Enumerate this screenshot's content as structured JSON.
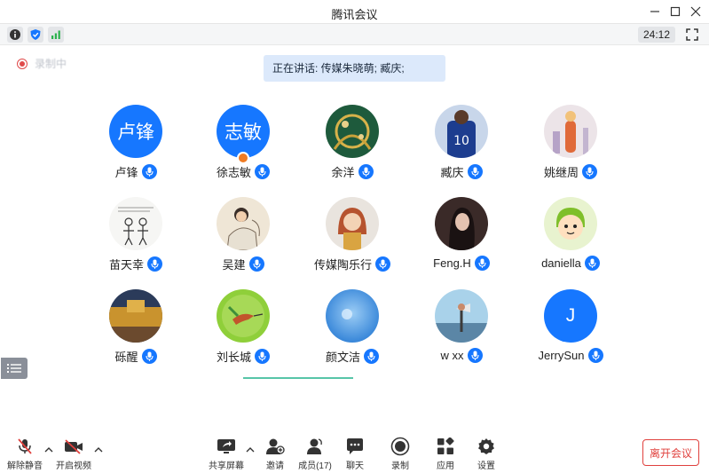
{
  "window": {
    "title": "腾讯会议"
  },
  "infobar": {
    "timer": "24:12"
  },
  "recording": {
    "label": "录制中"
  },
  "speaking": {
    "text": "正在讲话: 传媒朱晓萌; 臧庆;"
  },
  "participants": [
    {
      "name": "卢锋",
      "avatar_text": "卢锋"
    },
    {
      "name": "徐志敏",
      "avatar_text": "志敏"
    },
    {
      "name": "余洋"
    },
    {
      "name": "臧庆"
    },
    {
      "name": "姚继周"
    },
    {
      "name": "苗天幸"
    },
    {
      "name": "吴建"
    },
    {
      "name": "传媒陶乐行"
    },
    {
      "name": "Feng.H"
    },
    {
      "name": "daniella"
    },
    {
      "name": "砾醒"
    },
    {
      "name": "刘长城"
    },
    {
      "name": "颜文洁"
    },
    {
      "name": "w xx"
    },
    {
      "name": "JerrySun",
      "avatar_text": "J"
    }
  ],
  "toolbar": {
    "unmute": "解除静音",
    "start_video": "开启视频",
    "share_screen": "共享屏幕",
    "invite": "邀请",
    "members": "成员(17)",
    "chat": "聊天",
    "record": "录制",
    "apps": "应用",
    "settings": "设置",
    "leave": "离开会议"
  },
  "colors": {
    "accent": "#1677ff",
    "danger": "#e0403d",
    "banner": "#dce9fb"
  }
}
